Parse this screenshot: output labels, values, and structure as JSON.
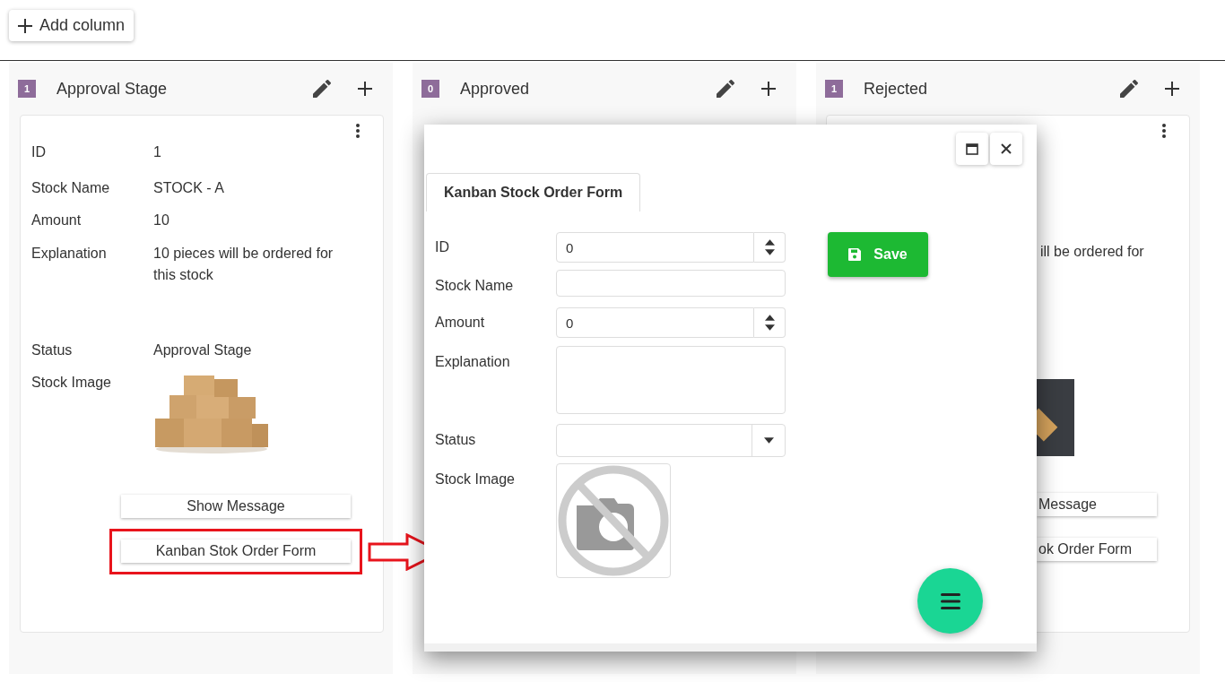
{
  "toolbar": {
    "add_column": "Add column"
  },
  "columns": [
    {
      "kind": "full",
      "count": "1",
      "title": "Approval Stage",
      "card": {
        "fields": [
          {
            "kind": "text",
            "label": "ID",
            "value": "1"
          },
          {
            "kind": "text",
            "label": "Stock Name",
            "value": "STOCK - A"
          },
          {
            "kind": "text",
            "label": "Amount",
            "value": "10"
          },
          {
            "kind": "text",
            "label": "Explanation",
            "value": "10 pieces will be ordered for this stock"
          },
          {
            "kind": "text",
            "label": "Status",
            "value": "Approval Stage"
          },
          {
            "kind": "image",
            "label": "Stock Image"
          }
        ],
        "buttons": [
          {
            "label": "Show Message",
            "highlighted": false
          },
          {
            "label": "Kanban Stok Order Form",
            "highlighted": true
          }
        ]
      }
    },
    {
      "kind": "empty",
      "count": "0",
      "title": "Approved"
    },
    {
      "kind": "covered",
      "count": "1",
      "title": "Rejected",
      "card": {
        "explanation_fragment": "ill be ordered for",
        "image": true,
        "buttons": [
          {
            "label": "Message"
          },
          {
            "label": "ok Order Form"
          }
        ]
      }
    }
  ],
  "dialog": {
    "tab": "Kanban Stock Order Form",
    "fields": [
      {
        "kind": "number",
        "label": "ID",
        "value": "0"
      },
      {
        "kind": "text",
        "label": "Stock Name"
      },
      {
        "kind": "number",
        "label": "Amount",
        "value": "0"
      },
      {
        "kind": "textarea",
        "label": "Explanation"
      },
      {
        "kind": "dropdown",
        "label": "Status"
      },
      {
        "kind": "image",
        "label": "Stock Image"
      }
    ],
    "save": "Save"
  }
}
